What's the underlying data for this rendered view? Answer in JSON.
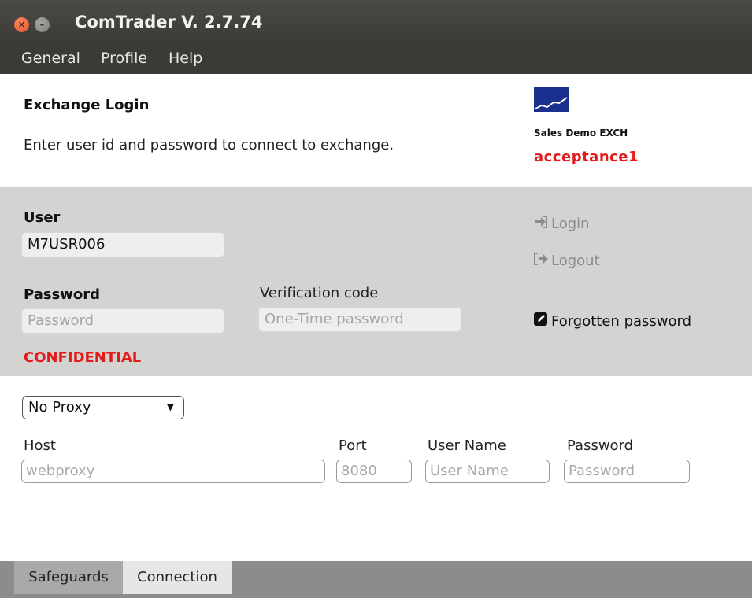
{
  "window": {
    "title": "ComTrader V. 2.7.74",
    "close_glyph": "×",
    "minimize_glyph": "–"
  },
  "menu": {
    "items": [
      "General",
      "Profile",
      "Help"
    ]
  },
  "header": {
    "title": "Exchange Login",
    "description": "Enter user id and password to connect to exchange.",
    "exchange_name": "Sales Demo EXCH",
    "environment": "acceptance1"
  },
  "login": {
    "user_label": "User",
    "user_value": "M7USR006",
    "password_label": "Password",
    "password_placeholder": "Password",
    "verification_label": "Verification code",
    "verification_placeholder": "One-Time password",
    "confidential_label": "CONFIDENTIAL",
    "login_label": "Login",
    "logout_label": "Logout",
    "forgotten_label": "Forgotten password"
  },
  "proxy": {
    "mode": "No Proxy",
    "host_label": "Host",
    "host_placeholder": "webproxy",
    "port_label": "Port",
    "port_placeholder": "8080",
    "username_label": "User Name",
    "username_placeholder": "User Name",
    "password_label": "Password",
    "password_placeholder": "Password"
  },
  "tabs": [
    "Safeguards",
    "Connection"
  ],
  "colors": {
    "titlebar": "#3b3a37",
    "panel_gray": "#d3d3d1",
    "accent_red": "#e31b1b",
    "logo_blue": "#1b2f8e",
    "tabbar": "#8c8c8a"
  },
  "icons": {
    "login": "sign-in-icon",
    "logout": "sign-out-icon",
    "forgotten": "edit-icon",
    "dropdown": "caret-down-icon"
  }
}
